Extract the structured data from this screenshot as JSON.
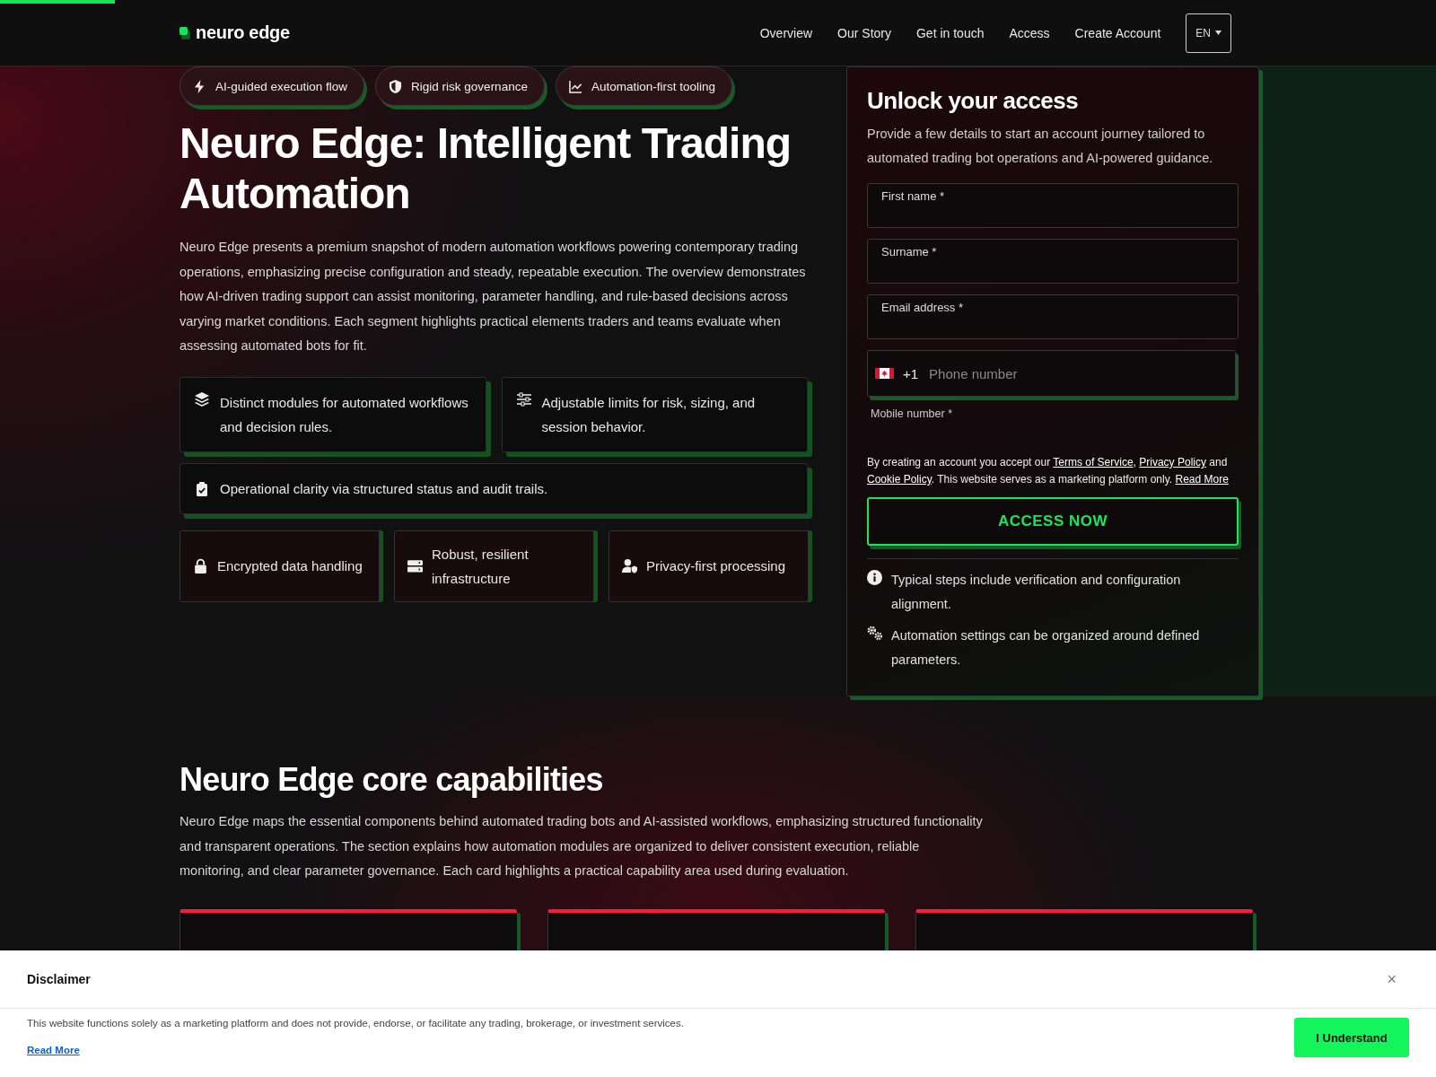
{
  "progress": {
    "level": 0.08
  },
  "header": {
    "logo": "neuro edge",
    "nav": [
      {
        "label": "Overview"
      },
      {
        "label": "Our Story"
      },
      {
        "label": "Get in touch"
      },
      {
        "label": "Access"
      },
      {
        "label": "Create Account"
      }
    ],
    "language": "EN"
  },
  "hero": {
    "chips": [
      {
        "label": "AI-guided execution flow"
      },
      {
        "label": "Rigid risk governance"
      },
      {
        "label": "Automation-first tooling"
      }
    ],
    "title": "Neuro Edge: Intelligent Trading Automation",
    "intro": "Neuro Edge presents a premium snapshot of modern automation workflows powering contemporary trading operations, emphasizing precise configuration and steady, repeatable execution. The overview demonstrates how AI-driven trading support can assist monitoring, parameter handling, and rule-based decisions across varying market conditions. Each segment highlights practical elements traders and teams evaluate when assessing automated bots for fit.",
    "features": [
      {
        "text": "Distinct modules for automated workflows and decision rules."
      },
      {
        "text": "Adjustable limits for risk, sizing, and session behavior."
      },
      {
        "text": "Operational clarity via structured status and audit trails."
      }
    ],
    "badges": [
      {
        "text": "Encrypted data handling"
      },
      {
        "text": "Robust, resilient infrastructure"
      },
      {
        "text": "Privacy-first processing"
      }
    ]
  },
  "signup": {
    "title": "Unlock your access",
    "subtitle": "Provide a few details to start an account journey tailored to automated trading bot operations and AI-powered guidance.",
    "fields": [
      {
        "label": "First name *"
      },
      {
        "label": "Surname *"
      },
      {
        "label": "Email address *"
      }
    ],
    "phone": {
      "dial_code": "+1",
      "placeholder": "Phone number",
      "label": "Mobile number *"
    },
    "consent": [
      {
        "kind": "text",
        "text": "By creating an account you accept our "
      },
      {
        "kind": "link",
        "text": "Terms of Service"
      },
      {
        "kind": "text",
        "text": ", "
      },
      {
        "kind": "link",
        "text": "Privacy Policy"
      },
      {
        "kind": "text",
        "text": " and "
      },
      {
        "kind": "link",
        "text": "Cookie Policy"
      },
      {
        "kind": "text",
        "text": ". This website serves as a marketing platform only. "
      },
      {
        "kind": "link",
        "text": "Read More"
      }
    ],
    "button": "ACCESS NOW",
    "notes": [
      {
        "text": "Typical steps include verification and configuration alignment."
      },
      {
        "text": "Automation settings can be organized around defined parameters."
      }
    ]
  },
  "capabilities": {
    "title": "Neuro Edge core capabilities",
    "intro": "Neuro Edge maps the essential components behind automated trading bots and AI-assisted workflows, emphasizing structured functionality and transparent operations. The section explains how automation modules are organized to deliver consistent execution, reliable monitoring, and clear parameter governance. Each card highlights a practical capability area used during evaluation.",
    "cards": [
      {
        "kind": "card"
      },
      {
        "kind": "card"
      },
      {
        "kind": "card"
      }
    ]
  },
  "disclaimer": {
    "title": "Disclaimer",
    "close": "×",
    "text": "This website functions solely as a marketing platform and does not provide, endorse, or facilitate any trading, brokerage, or investment services.",
    "link": "Read More",
    "button": "I Understand"
  }
}
